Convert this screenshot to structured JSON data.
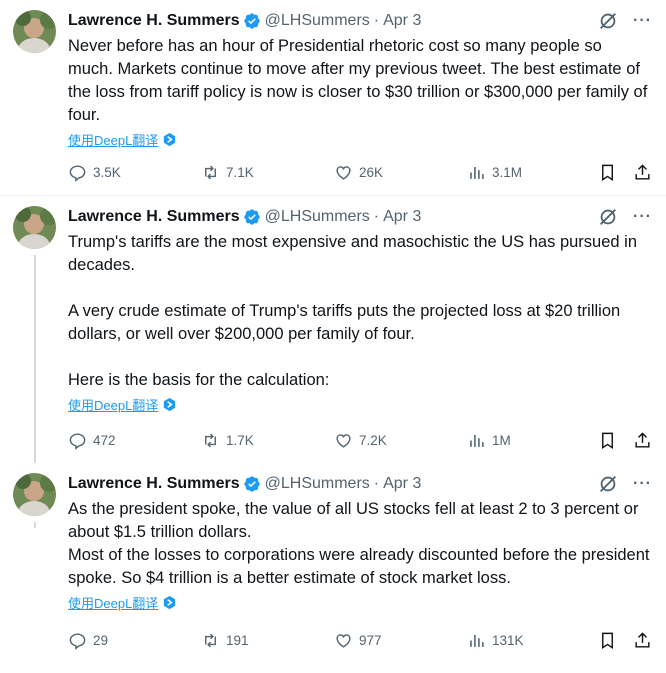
{
  "tweets": [
    {
      "name": "Lawrence H. Summers",
      "handle": "@LHSummers",
      "dot": "·",
      "date": "Apr 3",
      "text": "Never before has an hour of Presidential rhetoric cost so many people so much. Markets continue to move after my previous tweet. The best estimate of the loss from tariff policy is now is closer to $30 trillion or $300,000 per family of four.",
      "translate": "使用DeepL翻译",
      "replies": "3.5K",
      "reposts": "7.1K",
      "likes": "26K",
      "views": "3.1M"
    },
    {
      "name": "Lawrence H. Summers",
      "handle": "@LHSummers",
      "dot": "·",
      "date": "Apr 3",
      "text": "Trump's tariffs are the most expensive and masochistic the US has pursued in decades.\n\nA very crude estimate of Trump's tariffs puts the projected loss at $20 trillion dollars, or well over $200,000 per family of four.\n\nHere is the basis for the calculation:",
      "translate": "使用DeepL翻译",
      "replies": "472",
      "reposts": "1.7K",
      "likes": "7.2K",
      "views": "1M"
    },
    {
      "name": "Lawrence H. Summers",
      "handle": "@LHSummers",
      "dot": "·",
      "date": "Apr 3",
      "text": "As the president spoke, the value of all US stocks fell at least 2 to 3 percent or about $1.5 trillion dollars.\nMost of the losses to corporations were already discounted before the president spoke. So $4 trillion is a better estimate of stock market loss.",
      "translate": "使用DeepL翻译",
      "replies": "29",
      "reposts": "191",
      "likes": "977",
      "views": "131K"
    }
  ],
  "colors": {
    "accent": "#1d9bf0",
    "muted": "#536471",
    "text": "#0f1419",
    "verified": "#1d9bf0"
  },
  "icons": [
    "verified-badge-icon",
    "grok-icon",
    "more-icon",
    "deepl-icon",
    "reply-icon",
    "repost-icon",
    "like-icon",
    "views-icon",
    "bookmark-icon",
    "share-icon"
  ]
}
